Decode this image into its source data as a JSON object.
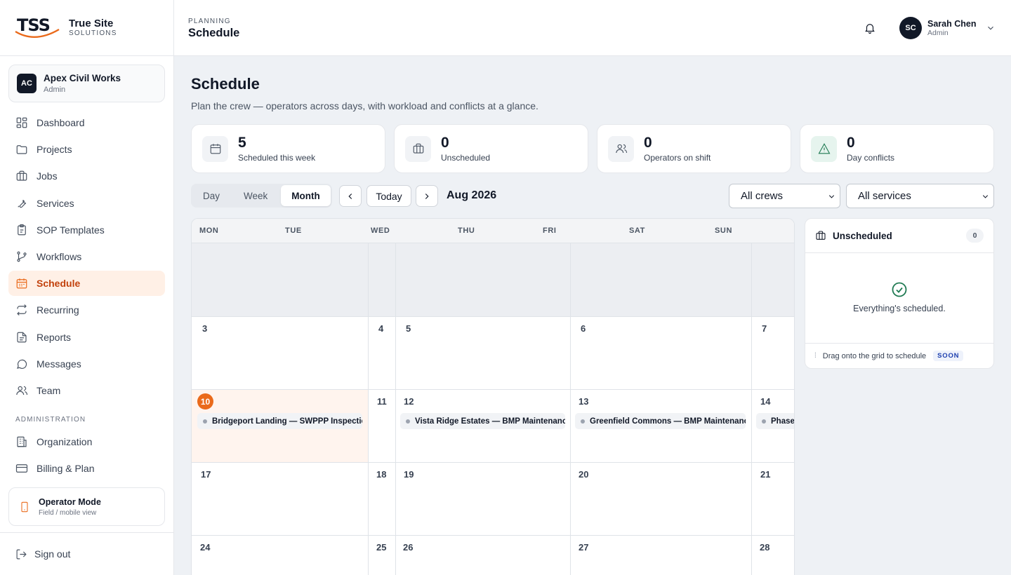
{
  "brand": {
    "logo_text": "TSS",
    "name_line1": "True Site",
    "name_line2": "SOLUTIONS",
    "accent_color": "#ea6a1b"
  },
  "org": {
    "initials": "AC",
    "name": "Apex Civil Works",
    "role": "Admin"
  },
  "nav": {
    "items": [
      {
        "label": "Dashboard",
        "icon": "dashboard-icon"
      },
      {
        "label": "Projects",
        "icon": "folder-icon"
      },
      {
        "label": "Jobs",
        "icon": "briefcase-icon"
      },
      {
        "label": "Services",
        "icon": "wrench-icon"
      },
      {
        "label": "SOP Templates",
        "icon": "clipboard-icon"
      },
      {
        "label": "Workflows",
        "icon": "workflow-icon"
      },
      {
        "label": "Schedule",
        "icon": "calendar-icon",
        "active": true
      },
      {
        "label": "Recurring",
        "icon": "repeat-icon"
      },
      {
        "label": "Reports",
        "icon": "document-icon"
      },
      {
        "label": "Messages",
        "icon": "chat-icon"
      },
      {
        "label": "Team",
        "icon": "users-icon"
      }
    ],
    "admin_section_label": "ADMINISTRATION",
    "admin_items": [
      {
        "label": "Organization",
        "icon": "building-icon"
      },
      {
        "label": "Billing & Plan",
        "icon": "credit-card-icon"
      }
    ]
  },
  "operator_mode": {
    "title": "Operator Mode",
    "subtitle": "Field / mobile view"
  },
  "signout_label": "Sign out",
  "topbar": {
    "section": "PLANNING",
    "title": "Schedule"
  },
  "user": {
    "initials": "SC",
    "name": "Sarah Chen",
    "role": "Admin"
  },
  "page": {
    "title": "Schedule",
    "subtitle": "Plan the crew — operators across days, with workload and conflicts at a glance."
  },
  "stats": [
    {
      "value": "5",
      "label": "Scheduled this week",
      "icon": "calendar-icon"
    },
    {
      "value": "0",
      "label": "Unscheduled",
      "icon": "briefcase-icon"
    },
    {
      "value": "0",
      "label": "Operators on shift",
      "icon": "users-icon"
    },
    {
      "value": "0",
      "label": "Day conflicts",
      "icon": "warning-icon"
    }
  ],
  "view_tabs": [
    {
      "label": "Day"
    },
    {
      "label": "Week"
    },
    {
      "label": "Month",
      "active": true
    }
  ],
  "today_label": "Today",
  "month_label": "Aug 2026",
  "filters": {
    "crew": "All crews",
    "service": "All services"
  },
  "calendar": {
    "weekdays": [
      "MON",
      "TUE",
      "WED",
      "THU",
      "FRI",
      "SAT",
      "SUN"
    ],
    "weeks": [
      [
        "3",
        "4",
        "5",
        "6",
        "7"
      ],
      [
        "10",
        "11",
        "12",
        "13",
        "14"
      ],
      [
        "17",
        "18",
        "19",
        "20",
        "21"
      ],
      [
        "24",
        "25",
        "26",
        "27",
        "28"
      ]
    ],
    "events": [
      {
        "day": "10",
        "title": "Bridgeport Landing — SWPPP Inspection"
      },
      {
        "day": "12",
        "title": "Vista Ridge Estates — BMP Maintenance"
      },
      {
        "day": "13",
        "title": "Greenfield Commons — BMP Maintenance"
      },
      {
        "day": "14",
        "title": "Phase"
      }
    ]
  },
  "unscheduled": {
    "title": "Unscheduled",
    "count": "0",
    "empty_text": "Everything's scheduled.",
    "footer_text": "Drag onto the grid to schedule",
    "footer_badge": "SOON"
  }
}
